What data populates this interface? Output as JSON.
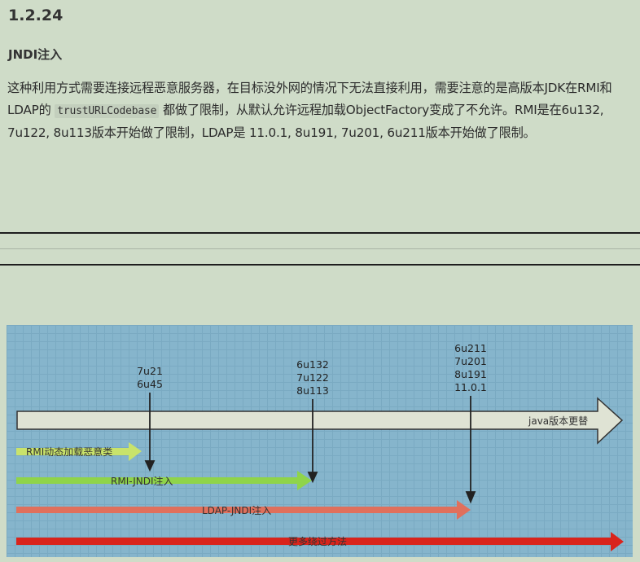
{
  "section": {
    "number": "1.2.24",
    "title": "JNDI注入"
  },
  "paragraph": {
    "part1": "这种利用方式需要连接远程恶意服务器，在目标没外网的情况下无法直接利用，需要注意的是高版本JDK在RMI和LDAP的",
    "code": "trustURLCodebase",
    "part2": "都做了限制，从默认允许远程加载ObjectFactory变成了不允许。RMI是在6u132, 7u122, 8u113版本开始做了限制，LDAP是 11.0.1, 8u191, 7u201, 6u211版本开始做了限制。"
  },
  "diagram": {
    "version_groups": [
      {
        "lines": [
          "7u21",
          "6u45"
        ]
      },
      {
        "lines": [
          "6u132",
          "7u122",
          "8u113"
        ]
      },
      {
        "lines": [
          "6u211",
          "7u201",
          "8u191",
          "11.0.1"
        ]
      }
    ],
    "arrows": {
      "java_updates": "java版本更替",
      "rmi_dynamic_load": "RMI动态加载恶意类",
      "rmi_jndi": "RMI-JNDI注入",
      "ldap_jndi": "LDAP-JNDI注入",
      "more_bypass": "更多绕过方法"
    },
    "colors": {
      "main_arrow": "#dfe3d4",
      "rmi_dynamic": "#c9e36b",
      "rmi_jndi": "#8fd44a",
      "ldap_jndi": "#e0705c",
      "more_bypass": "#d9241c"
    }
  }
}
